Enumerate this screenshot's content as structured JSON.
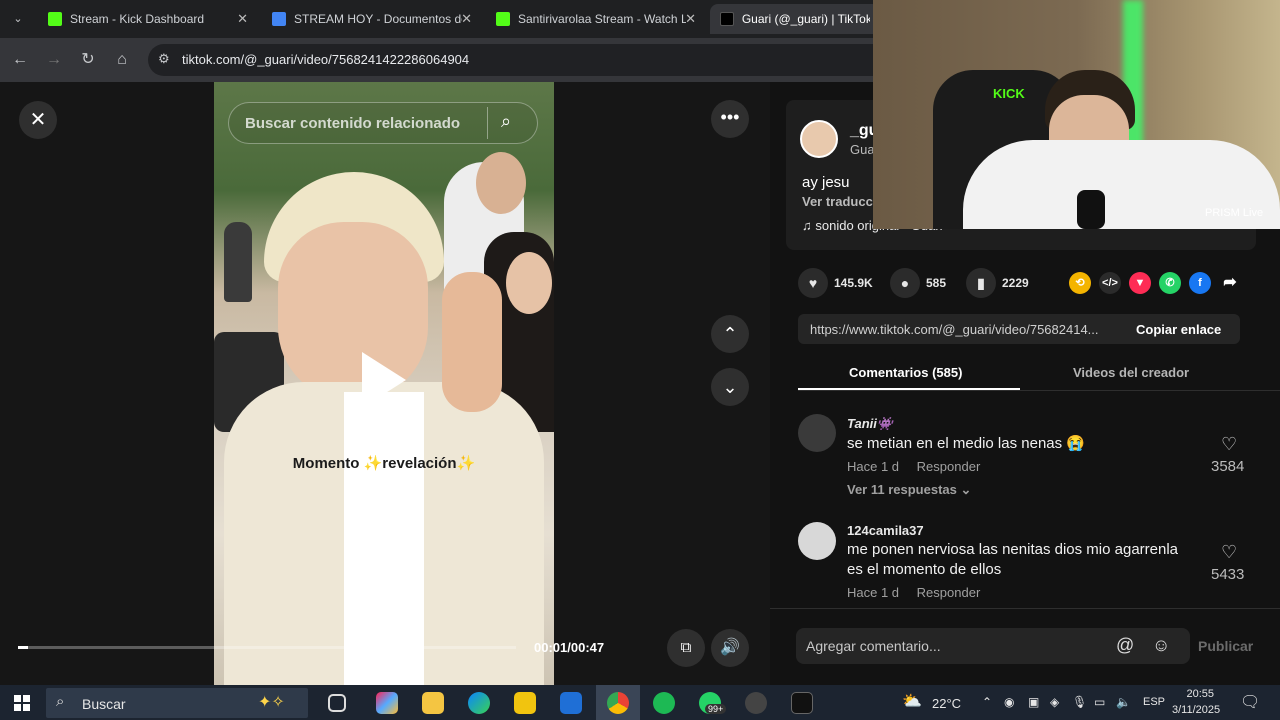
{
  "browser": {
    "tabs": [
      {
        "title": "Stream - Kick Dashboard",
        "favicon": "kick-icon",
        "color": "#53fc18"
      },
      {
        "title": "STREAM HOY - Documentos de",
        "favicon": "docs-icon",
        "color": "#4285f4"
      },
      {
        "title": "Santirivarolaa Stream - Watch L",
        "favicon": "kick-icon",
        "color": "#53fc18"
      },
      {
        "title": "Guari (@_guari) | TikTok",
        "favicon": "tiktok-icon",
        "color": "#ffffff"
      }
    ],
    "url": "tiktok.com/@_guari/video/7568241422286064904"
  },
  "video": {
    "search_placeholder": "Buscar contenido relacionado",
    "caption_overlay": "Momento ✨revelación✨",
    "time": "00:01/00:47",
    "progress": 0.02
  },
  "post": {
    "username": "_gu",
    "display_name": "Gua",
    "caption": "ay jesu",
    "see_translation": "Ver traducc",
    "sound": "sonido original · Guari",
    "likes": "145.9K",
    "comments": "585",
    "saves": "2229",
    "link": "https://www.tiktok.com/@_guari/video/75682414...",
    "copy_link": "Copiar enlace"
  },
  "tabs": {
    "comments": "Comentarios (585)",
    "creator_videos": "Videos del creador"
  },
  "comments": [
    {
      "name": "Tanii👾",
      "text": "se metian en el medio las nenas 😭",
      "time": "Hace 1 d",
      "reply": "Responder",
      "likes": "3584",
      "replies": "Ver 11 respuestas"
    },
    {
      "name": "124camila37",
      "text": "me ponen nerviosa las nenitas dios mio agarrenla es el momento de ellos",
      "time": "Hace 1 d",
      "reply": "Responder",
      "likes": "5433"
    }
  ],
  "comment_box": {
    "placeholder": "Agregar comentario...",
    "publish": "Publicar"
  },
  "webcam": {
    "chair_brand": "KICK",
    "watermark": "PRISM Live"
  },
  "taskbar": {
    "search": "Buscar",
    "weather": "22°C",
    "lang": "ESP",
    "time": "20:55",
    "date": "3/11/2025",
    "whatsapp_badge": "99+"
  }
}
